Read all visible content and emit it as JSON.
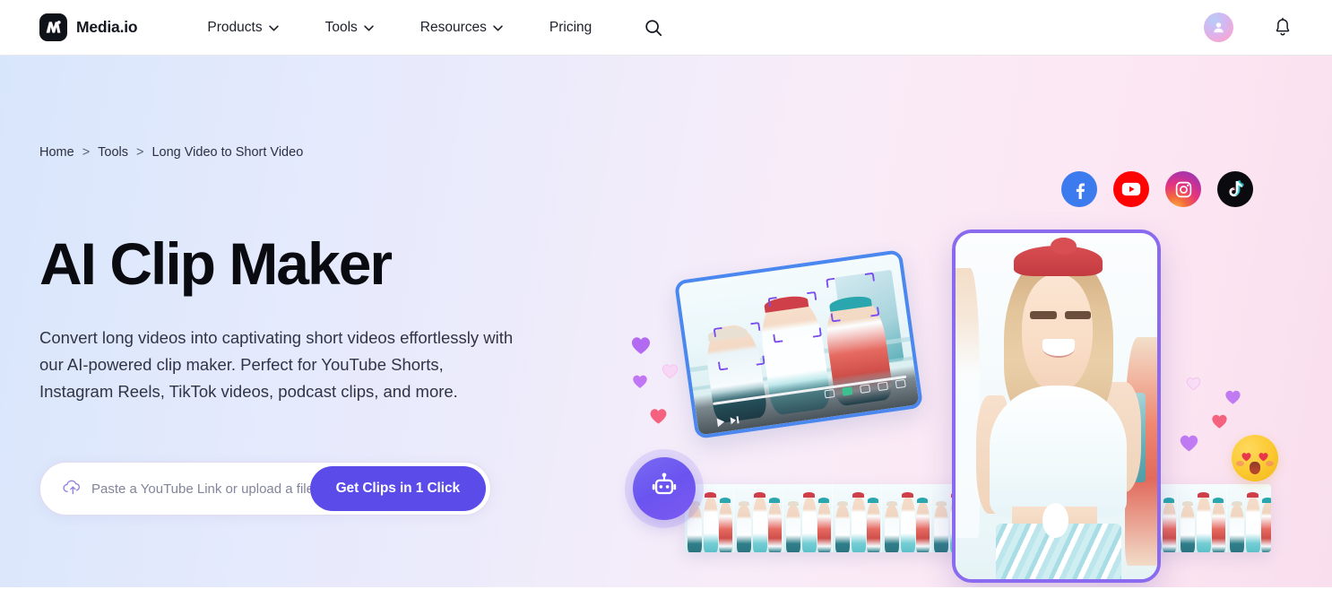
{
  "navbar": {
    "brand_name": "Media.io",
    "brand_logo_icon": "media-io-logo-icon",
    "links": [
      {
        "label": "Products",
        "has_caret": true
      },
      {
        "label": "Tools",
        "has_caret": true
      },
      {
        "label": "Resources",
        "has_caret": true
      },
      {
        "label": "Pricing",
        "has_caret": false
      }
    ],
    "search_icon": "search-icon",
    "avatar_icon": "user-avatar-icon",
    "bell_icon": "notification-bell-icon"
  },
  "breadcrumb": {
    "items": [
      "Home",
      "Tools",
      "Long Video to Short Video"
    ],
    "separator": ">"
  },
  "hero": {
    "title": "AI Clip Maker",
    "description": "Convert long videos into captivating short videos effortlessly with our AI-powered clip maker. Perfect for YouTube Shorts, Instagram Reels, TikTok videos, podcast clips, and more.",
    "input": {
      "placeholder": "Paste a YouTube Link or upload a file",
      "value": "",
      "icon": "cloud-upload-icon"
    },
    "cta_label": "Get Clips in 1 Click",
    "cta_color": "#5B4BE8"
  },
  "socials": [
    {
      "name": "facebook",
      "color": "#3B7BED"
    },
    {
      "name": "youtube",
      "color": "#FF0202"
    },
    {
      "name": "instagram",
      "color": "#E6347F"
    },
    {
      "name": "tiktok",
      "color": "#0B0B0F"
    }
  ],
  "artwork": {
    "video_card_border": "#4A87EF",
    "phone_card_border": "#8A6BF0",
    "ai_badge_icon": "robot-icon",
    "face_detect_boxes": 3,
    "filmstrip_frames": 12,
    "hearts": [
      {
        "color": "#B36AF2",
        "size": 26
      },
      {
        "color": "#C176F5",
        "size": 20
      },
      {
        "color": "#F6C9EE",
        "size": 20
      },
      {
        "color": "#F4627F",
        "size": 22
      },
      {
        "color": "#F7D0F0",
        "size": 18
      },
      {
        "color": "#C07BF3",
        "size": 20
      },
      {
        "color": "#F4627F",
        "size": 20
      },
      {
        "color": "#C07BF3",
        "size": 24
      }
    ],
    "emoji": "heart-eyes-emoji"
  },
  "theme": {
    "background_gradient_start": "#D8E6FB",
    "background_gradient_end": "#F9DFEE",
    "text_color": "#0A0B10"
  }
}
